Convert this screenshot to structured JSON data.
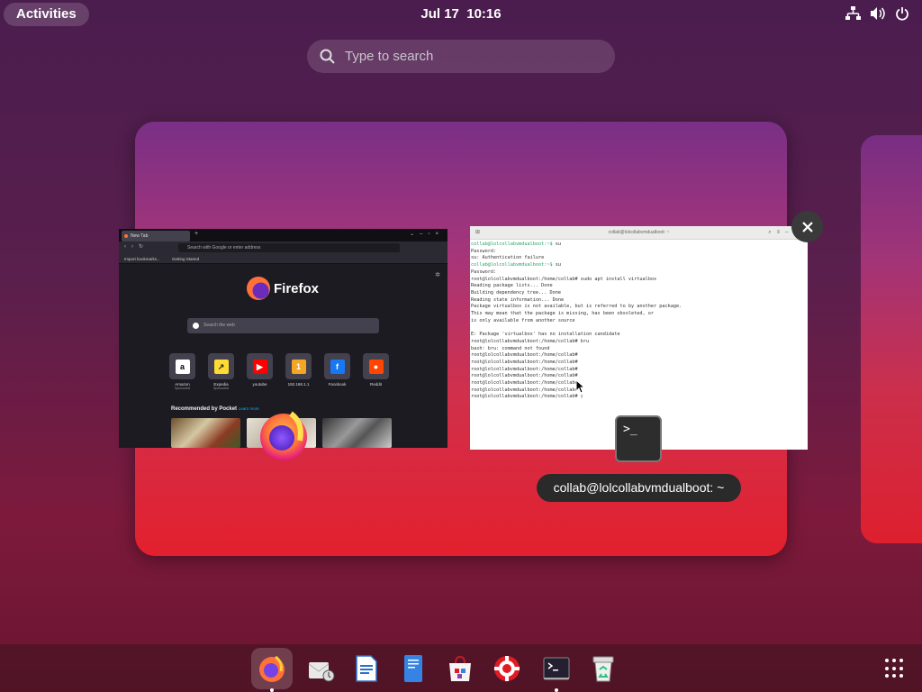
{
  "topbar": {
    "activities_label": "Activities",
    "clock": "Jul 17  10:16",
    "tray_icons": [
      "network-icon",
      "volume-icon",
      "power-icon"
    ]
  },
  "search": {
    "placeholder": "Type to search"
  },
  "firefox_window": {
    "tab_label": "New Tab",
    "url_placeholder": "Search with Google or enter address",
    "bookmarks": [
      "Import bookmarks...",
      "Getting Started"
    ],
    "logo_text": "Firefox",
    "search_placeholder": "Search the web",
    "top_sites": [
      {
        "label": "Amazon",
        "sub": "Sponsored",
        "icon": "amazon-icon",
        "color": "#ffffff",
        "glyph": "a"
      },
      {
        "label": "Expedia",
        "sub": "Sponsored",
        "icon": "expedia-icon",
        "color": "#fddb32",
        "glyph": "↗"
      },
      {
        "label": "youtube",
        "sub": "",
        "icon": "youtube-icon",
        "color": "#ff0000",
        "glyph": "▶"
      },
      {
        "label": "192.168.1.1",
        "sub": "",
        "icon": "router-icon",
        "color": "#f5a623",
        "glyph": "1"
      },
      {
        "label": "Facebook",
        "sub": "",
        "icon": "facebook-icon",
        "color": "#1877f2",
        "glyph": "f"
      },
      {
        "label": "Reddit",
        "sub": "",
        "icon": "reddit-icon",
        "color": "#ff4500",
        "glyph": "●"
      }
    ],
    "pocket_heading": "Recommended by Pocket",
    "pocket_link": "Learn more"
  },
  "terminal_window": {
    "title": "collab@lolcollabvmdualboot: ~",
    "lines": [
      [
        "collab@lolcollabvmdualboot:~$ ",
        "su"
      ],
      [
        "",
        "Password:"
      ],
      [
        "",
        "su: Authentication failure"
      ],
      [
        "collab@lolcollabvmdualboot:~$ ",
        "su"
      ],
      [
        "",
        "Password:"
      ],
      [
        "",
        "root@lolcollabvmdualboot:/home/collab# sudo apt install virtualbox"
      ],
      [
        "",
        "Reading package lists... Done"
      ],
      [
        "",
        "Building dependency tree... Done"
      ],
      [
        "",
        "Reading state information... Done"
      ],
      [
        "",
        "Package virtualbox is not available, but is referred to by another package."
      ],
      [
        "",
        "This may mean that the package is missing, has been obsoleted, or"
      ],
      [
        "",
        "is only available from another source"
      ],
      [
        "",
        ""
      ],
      [
        "",
        "E: Package 'virtualbox' has no installation candidate"
      ],
      [
        "",
        "root@lolcollabvmdualboot:/home/collab# bru"
      ],
      [
        "",
        "bash: bru: command not found"
      ],
      [
        "",
        "root@lolcollabvmdualboot:/home/collab#"
      ],
      [
        "",
        "root@lolcollabvmdualboot:/home/collab#"
      ],
      [
        "",
        "root@lolcollabvmdualboot:/home/collab#"
      ],
      [
        "",
        "root@lolcollabvmdualboot:/home/collab#"
      ],
      [
        "",
        "root@lolcollabvmdualboot:/home/collab#"
      ],
      [
        "",
        "root@lolcollabvmdualboot:/home/collab#"
      ],
      [
        "",
        "root@lolcollabvmdualboot:/home/collab# ▯"
      ]
    ],
    "label": "collab@lolcollabvmdualboot: ~",
    "app_glyph": ">_"
  },
  "dash": {
    "items": [
      {
        "name": "firefox-icon",
        "active": true,
        "running": true
      },
      {
        "name": "evolution-icon",
        "active": false,
        "running": false
      },
      {
        "name": "writer-icon",
        "active": false,
        "running": false
      },
      {
        "name": "text-editor-icon",
        "active": false,
        "running": false
      },
      {
        "name": "software-icon",
        "active": false,
        "running": false
      },
      {
        "name": "help-icon",
        "active": false,
        "running": false
      },
      {
        "name": "terminal-icon",
        "active": false,
        "running": true
      },
      {
        "name": "trash-icon",
        "active": false,
        "running": false
      }
    ],
    "show_apps": "show-apps-icon"
  },
  "colors": {
    "accent": "#e3202e",
    "terminal_prompt": "#26a269",
    "dash_bg": "#3c141e"
  }
}
